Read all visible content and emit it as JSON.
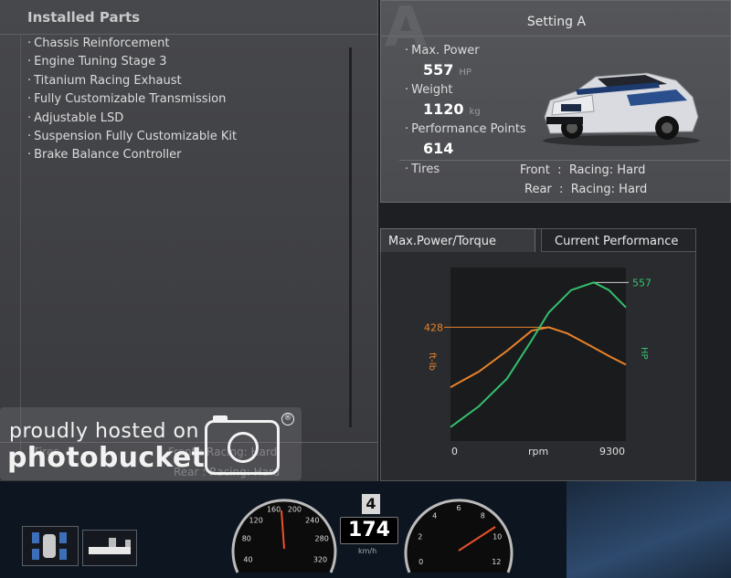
{
  "installed_parts": {
    "title": "Installed Parts",
    "items": [
      "Chassis Reinforcement",
      "Engine Tuning Stage 3",
      "Titanium Racing Exhaust",
      "Fully Customizable Transmission",
      "Adjustable LSD",
      "Suspension Fully Customizable Kit",
      "Brake Balance Controller"
    ]
  },
  "ghost_tires": {
    "label": "Tires",
    "front": "Front  :  Racing: Hard",
    "rear": "Rear  :  Racing: Hard"
  },
  "watermark": {
    "line1": "proudly hosted on",
    "line2": "photobucket",
    "reg": "®"
  },
  "setting": {
    "letter": "A",
    "title": "Setting A",
    "max_power_label": "Max. Power",
    "max_power_value": "557",
    "max_power_unit": "HP",
    "weight_label": "Weight",
    "weight_value": "1120",
    "weight_unit": "kg",
    "pp_label": "Performance Points",
    "pp_value": "614",
    "tires_label": "Tires",
    "front_label": "Front",
    "front_value": "Racing: Hard",
    "rear_label": "Rear",
    "rear_value": "Racing: Hard",
    "sep": ":"
  },
  "tabs": {
    "active": "Max.Power/Torque",
    "inactive": "Current Performance"
  },
  "chart_data": {
    "type": "line",
    "xlabel": "rpm",
    "x_range": [
      0,
      9300
    ],
    "y_left_label": "ft-lb",
    "y_right_label": "HP",
    "torque_peak": "428",
    "power_peak": "557",
    "x_start": "0",
    "x_end": "9300",
    "series": [
      {
        "name": "ft-lb",
        "color": "#e8822a",
        "points": [
          [
            0,
            255
          ],
          [
            1500,
            300
          ],
          [
            3000,
            360
          ],
          [
            4300,
            418
          ],
          [
            5200,
            428
          ],
          [
            6200,
            410
          ],
          [
            7400,
            375
          ],
          [
            8400,
            345
          ],
          [
            9300,
            320
          ]
        ]
      },
      {
        "name": "HP",
        "color": "#33c06e",
        "points": [
          [
            0,
            140
          ],
          [
            1500,
            200
          ],
          [
            3000,
            280
          ],
          [
            4300,
            390
          ],
          [
            5200,
            470
          ],
          [
            6400,
            535
          ],
          [
            7600,
            557
          ],
          [
            8400,
            535
          ],
          [
            9300,
            485
          ]
        ]
      }
    ]
  },
  "hud": {
    "gear": "4",
    "speed": "174",
    "speed_unit": "km/h",
    "speedo_ticks": [
      "40",
      "80",
      "120",
      "160",
      "200",
      "240",
      "280",
      "320"
    ],
    "tacho_ticks": [
      "0",
      "2",
      "4",
      "6",
      "8",
      "10",
      "12"
    ]
  }
}
